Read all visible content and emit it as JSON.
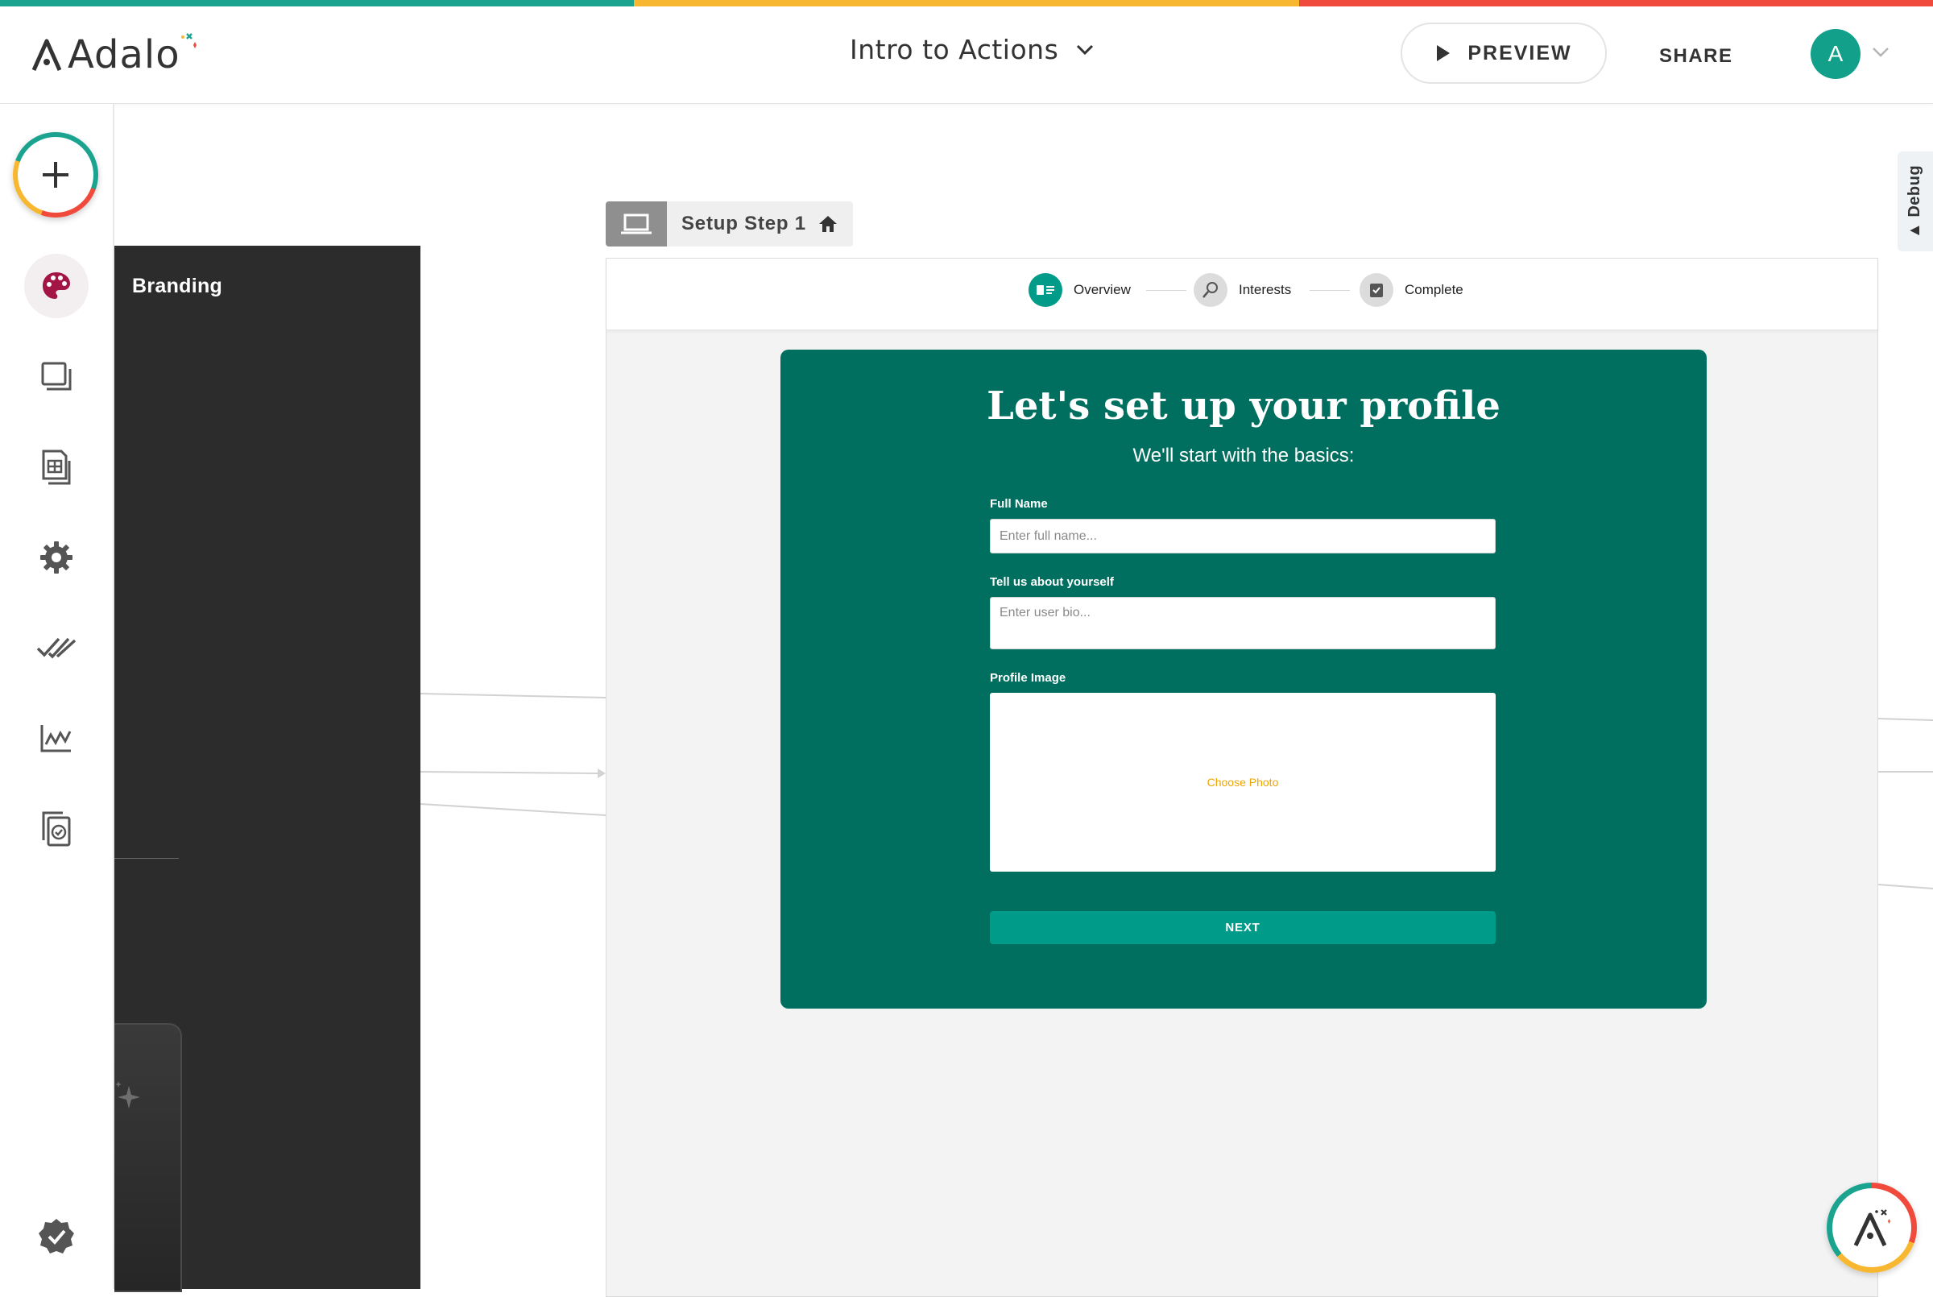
{
  "app": {
    "brand": "Adalo",
    "project_title": "Intro to Actions",
    "preview_label": "PREVIEW",
    "share_label": "SHARE",
    "user_initial": "A",
    "colors": {
      "accent": "#13a08b",
      "card_green": "#006f5f",
      "button_teal": "#009c89",
      "photo_link": "#f0a500",
      "strip": [
        "#1aa38e",
        "#f8b731",
        "#ef4a3c"
      ]
    }
  },
  "toolbar": {
    "items": [
      {
        "icon": "plus-icon",
        "name": "add-component"
      },
      {
        "icon": "palette-icon",
        "name": "branding",
        "active": true
      },
      {
        "icon": "screens-icon",
        "name": "screens"
      },
      {
        "icon": "database-icon",
        "name": "database"
      },
      {
        "icon": "gear-icon",
        "name": "settings"
      },
      {
        "icon": "double-check-icon",
        "name": "publish"
      },
      {
        "icon": "analytics-icon",
        "name": "analytics"
      },
      {
        "icon": "copy-check-icon",
        "name": "versions"
      },
      {
        "icon": "badge-check-icon",
        "name": "checklist"
      }
    ]
  },
  "branding_panel": {
    "title": "Branding"
  },
  "screen": {
    "name": "Setup Step 1",
    "steps": [
      {
        "label": "Overview",
        "state": "active"
      },
      {
        "label": "Interests",
        "state": "inactive"
      },
      {
        "label": "Complete",
        "state": "inactive"
      }
    ],
    "form": {
      "title": "Let's set up your profile",
      "subtitle": "We'll start with the basics:",
      "full_name_label": "Full Name",
      "full_name_placeholder": "Enter full name...",
      "bio_label": "Tell us about yourself",
      "bio_placeholder": "Enter user bio...",
      "image_label": "Profile Image",
      "choose_photo": "Choose Photo",
      "next_label": "NEXT"
    }
  },
  "debug_tab": {
    "label": "Debug"
  }
}
